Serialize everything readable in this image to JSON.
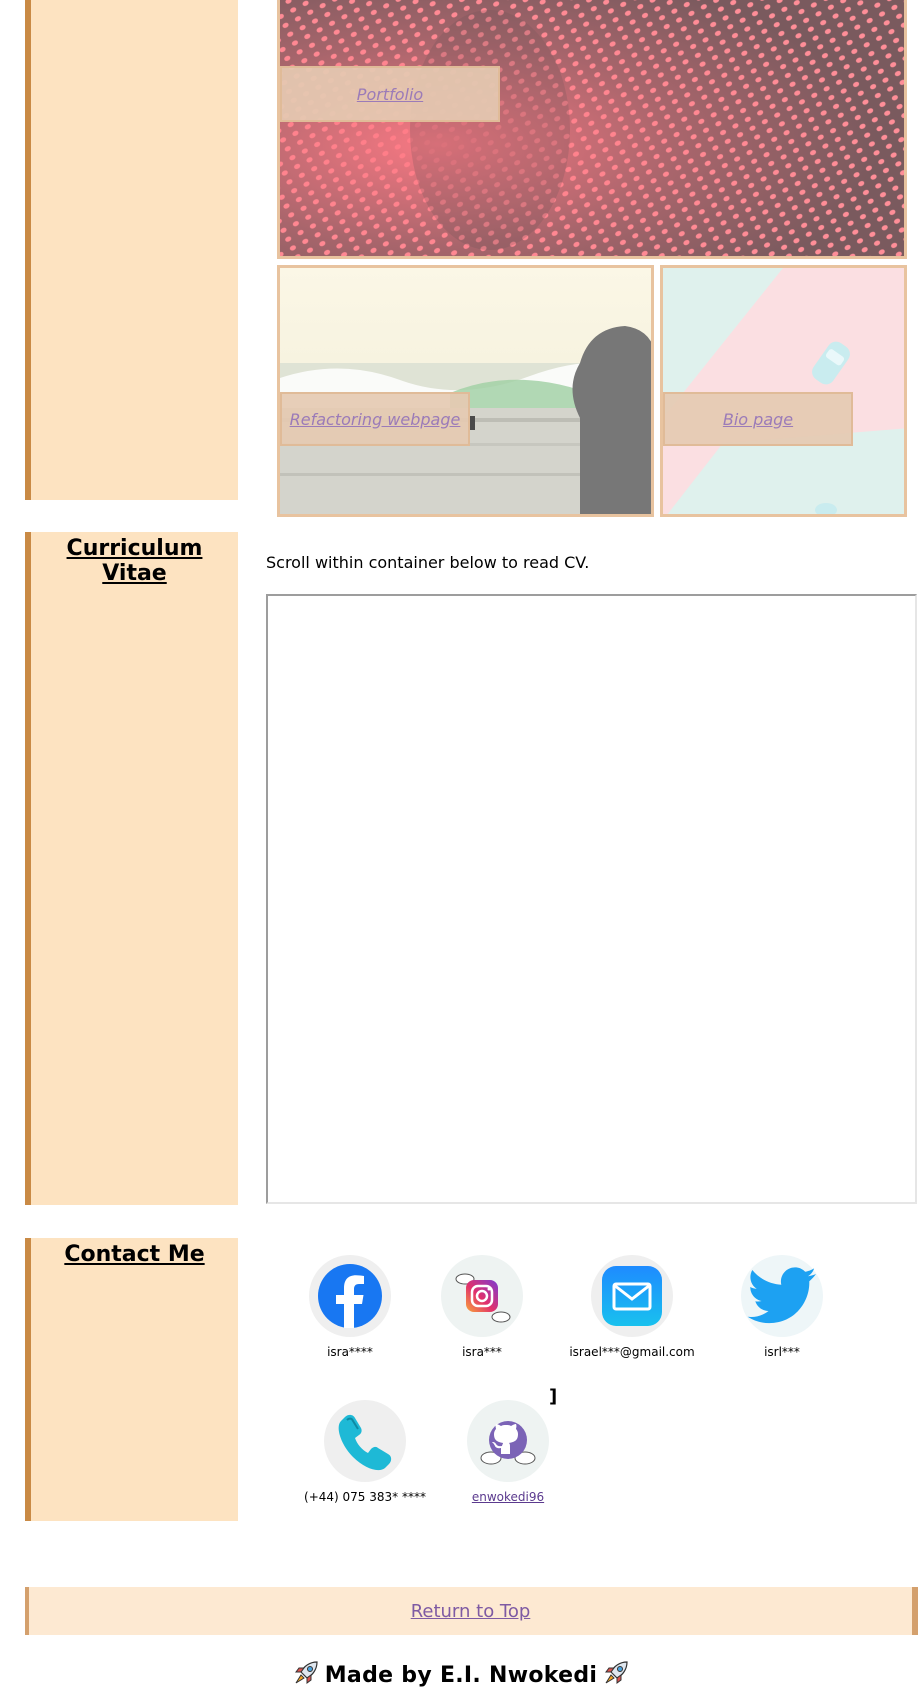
{
  "portfolio": {
    "tiles": [
      {
        "label": "Portfolio"
      },
      {
        "label": "Refactoring webpage"
      },
      {
        "label": "Bio page"
      }
    ]
  },
  "cv": {
    "heading": "Curriculum Vitae",
    "intro": "Scroll within container below to read CV."
  },
  "contact": {
    "heading": "Contact Me",
    "items": [
      {
        "icon": "facebook-icon",
        "label": "isra****"
      },
      {
        "icon": "instagram-icon",
        "label": "isra***"
      },
      {
        "icon": "email-icon",
        "label": "israel***@gmail.com"
      },
      {
        "icon": "twitter-icon",
        "label": "isrl***"
      },
      {
        "icon": "phone-icon",
        "label": "(+44) 075 383* ****"
      },
      {
        "icon": "github-icon",
        "label": "enwokedi96"
      }
    ],
    "stray_text": "]"
  },
  "footer": {
    "return_label": "Return to Top",
    "made_by": "Made by E.I. Nwokedi"
  },
  "colors": {
    "sidebar": "#fde3c1",
    "accent": "#c98a45",
    "link": "#7e5aa3"
  }
}
